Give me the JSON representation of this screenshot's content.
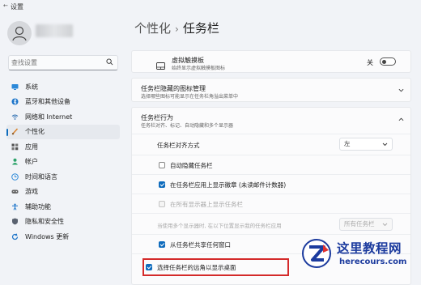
{
  "window": {
    "title": "设置"
  },
  "search": {
    "placeholder": "查找设置"
  },
  "sidebar": {
    "items": [
      {
        "label": "系统",
        "icon": "monitor-icon"
      },
      {
        "label": "蓝牙和其他设备",
        "icon": "bluetooth-icon"
      },
      {
        "label": "网络和 Internet",
        "icon": "wifi-icon"
      },
      {
        "label": "个性化",
        "icon": "brush-icon",
        "active": true
      },
      {
        "label": "应用",
        "icon": "apps-icon"
      },
      {
        "label": "帐户",
        "icon": "person-icon"
      },
      {
        "label": "时间和语言",
        "icon": "globe-clock-icon"
      },
      {
        "label": "游戏",
        "icon": "gamepad-icon"
      },
      {
        "label": "辅助功能",
        "icon": "accessibility-icon"
      },
      {
        "label": "隐私和安全性",
        "icon": "shield-icon"
      },
      {
        "label": "Windows 更新",
        "icon": "update-icon"
      }
    ]
  },
  "header": {
    "parent": "个性化",
    "separator": "›",
    "current": "任务栏"
  },
  "touchpad": {
    "title": "虚拟触摸板",
    "subtitle": "始终显示虚拟触摸板图标",
    "toggle_label": "关",
    "toggle_on": false
  },
  "hidden_icons": {
    "title": "任务栏隐藏的图标管理",
    "subtitle": "选择哪些图标可能显示在任务栏角溢出菜单中"
  },
  "behaviors": {
    "title": "任务栏行为",
    "subtitle": "任务栏对齐、标记、自动隐藏和多个显示器",
    "alignment": {
      "label": "任务栏对齐方式",
      "value": "左"
    },
    "options": [
      {
        "label": "自动隐藏任务栏",
        "checked": false,
        "disabled": false
      },
      {
        "label": "在任务栏应用上显示徽章 (未读邮件计数器)",
        "checked": true,
        "disabled": false
      },
      {
        "label": "在所有显示器上显示任务栏",
        "checked": false,
        "disabled": true
      }
    ],
    "multi_display": {
      "label": "当使用多个显示器时, 在以下位置显示我的任务栏应用",
      "value": "所有任务栏"
    },
    "options2": [
      {
        "label": "从任务栏共享任何窗口",
        "checked": true
      },
      {
        "label": "选择任务栏的远角以显示桌面",
        "checked": true
      }
    ]
  },
  "watermark": {
    "title": "这里教程网",
    "url": "herecours.com"
  },
  "colors": {
    "accent": "#0f6cbd",
    "highlight": "#d42a2a",
    "watermark": "#1c3b9e"
  }
}
